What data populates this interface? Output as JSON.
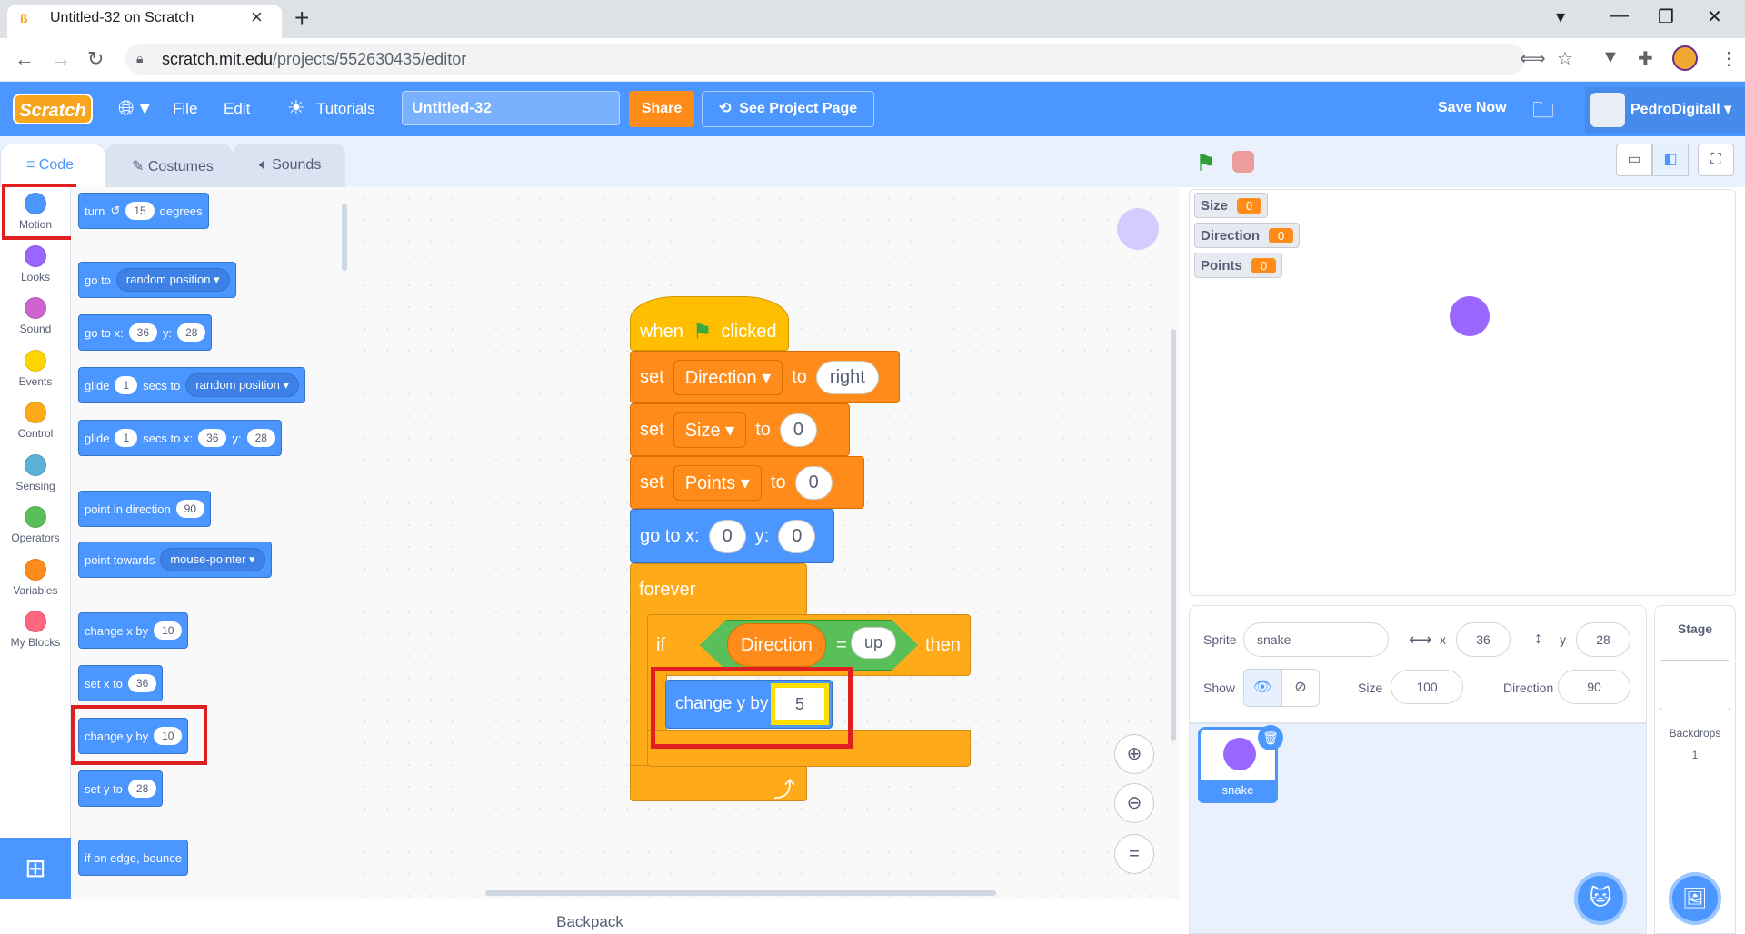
{
  "browser": {
    "tab_title": "Untitled-32 on Scratch",
    "url_host": "scratch.mit.edu",
    "url_path": "/projects/552630435/editor"
  },
  "menu": {
    "file": "File",
    "edit": "Edit",
    "tutorials": "Tutorials",
    "project_title": "Untitled-32",
    "share": "Share",
    "see_project": "See Project Page",
    "save_now": "Save Now",
    "username": "PedroDigitall"
  },
  "tabs": {
    "code": "Code",
    "costumes": "Costumes",
    "sounds": "Sounds"
  },
  "categories": [
    {
      "label": "Motion",
      "color": "#4c97ff"
    },
    {
      "label": "Looks",
      "color": "#9966ff"
    },
    {
      "label": "Sound",
      "color": "#cf63cf"
    },
    {
      "label": "Events",
      "color": "#ffd500"
    },
    {
      "label": "Control",
      "color": "#ffab19"
    },
    {
      "label": "Sensing",
      "color": "#5cb1d6"
    },
    {
      "label": "Operators",
      "color": "#59c059"
    },
    {
      "label": "Variables",
      "color": "#ff8c1a"
    },
    {
      "label": "My Blocks",
      "color": "#ff6680"
    }
  ],
  "palette": {
    "turn": "turn",
    "turn_val": "15",
    "degrees": "degrees",
    "goto": "go to",
    "random_position": "random position",
    "goto_xy": "go to x:",
    "x_val": "36",
    "y_lbl": "y:",
    "y_val": "28",
    "glide": "glide",
    "glide_secs": "1",
    "secs_to": "secs to",
    "secs_to_x": "secs to x:",
    "point_dir": "point in direction",
    "dir_val": "90",
    "point_towards": "point towards",
    "mouse_pointer": "mouse-pointer",
    "change_x": "change x by",
    "change_x_val": "10",
    "set_x": "set x to",
    "set_x_val": "36",
    "change_y": "change y by",
    "change_y_val": "10",
    "set_y": "set y to",
    "set_y_val": "28",
    "bounce": "if on edge, bounce"
  },
  "script": {
    "when": "when",
    "clicked": "clicked",
    "set": "set",
    "to": "to",
    "var_direction": "Direction",
    "val_right": "right",
    "var_size": "Size",
    "val_size": "0",
    "var_points": "Points",
    "val_points": "0",
    "goto_x": "go to x:",
    "x": "0",
    "y_lbl": "y:",
    "y": "0",
    "forever": "forever",
    "if": "if",
    "then": "then",
    "eq": "=",
    "val_up": "up",
    "change_y": "change y by",
    "change_y_val": "5"
  },
  "backpack": "Backpack",
  "monitors": [
    {
      "name": "Size",
      "value": "0"
    },
    {
      "name": "Direction",
      "value": "0"
    },
    {
      "name": "Points",
      "value": "0"
    }
  ],
  "sprite_info": {
    "sprite_lbl": "Sprite",
    "sprite_name": "snake",
    "x_lbl": "x",
    "x": "36",
    "y_lbl": "y",
    "y": "28",
    "show_lbl": "Show",
    "size_lbl": "Size",
    "size": "100",
    "direction_lbl": "Direction",
    "direction": "90"
  },
  "sprites": [
    {
      "name": "snake"
    }
  ],
  "stage_pane": {
    "title": "Stage",
    "backdrops_lbl": "Backdrops",
    "backdrops_count": "1"
  }
}
